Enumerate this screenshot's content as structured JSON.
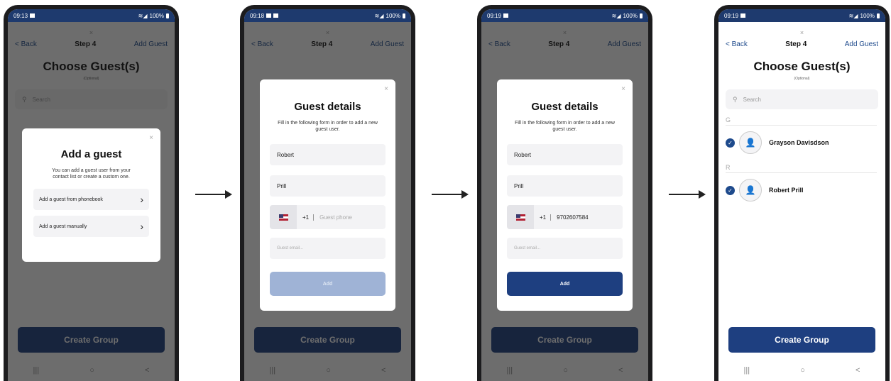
{
  "colors": {
    "primary": "#1e3f80",
    "statusbar": "#1e3a6e",
    "disabled_button": "#9fb3d6"
  },
  "screens": [
    {
      "time": "09:13",
      "battery": "100%"
    },
    {
      "time": "09:18",
      "battery": "100%"
    },
    {
      "time": "09:19",
      "battery": "100%"
    },
    {
      "time": "09:19",
      "battery": "100%"
    }
  ],
  "header": {
    "close_glyph": "×",
    "back": "< Back",
    "step": "Step 4",
    "add_guest": "Add Guest"
  },
  "page": {
    "title": "Choose Guest(s)",
    "subtitle": "(Optional)",
    "search_placeholder": "Search"
  },
  "contacts": [
    {
      "letter": "G",
      "name": "Grayson Davisdson"
    },
    {
      "letter": "R",
      "name": "Robert  Prill"
    }
  ],
  "create_button": "Create Group",
  "navbar": {
    "recent_icon": "|||",
    "home_icon": "○",
    "back_icon": "<"
  },
  "add_guest_modal": {
    "title": "Add a guest",
    "description": "You can add a guest user from your contact list or create a custom one.",
    "options": [
      "Add a guest from phonebook",
      "Add a guest manually"
    ]
  },
  "guest_details_modal": {
    "title": "Guest details",
    "description": "Fill in the following form in order to add a new guest user.",
    "first_name": "Robert",
    "last_name": "Prill",
    "country_code": "+1",
    "phone_placeholder": "Guest phone",
    "phone_value": "9702607584",
    "email_placeholder": "Guest email...",
    "add_label": "Add"
  }
}
